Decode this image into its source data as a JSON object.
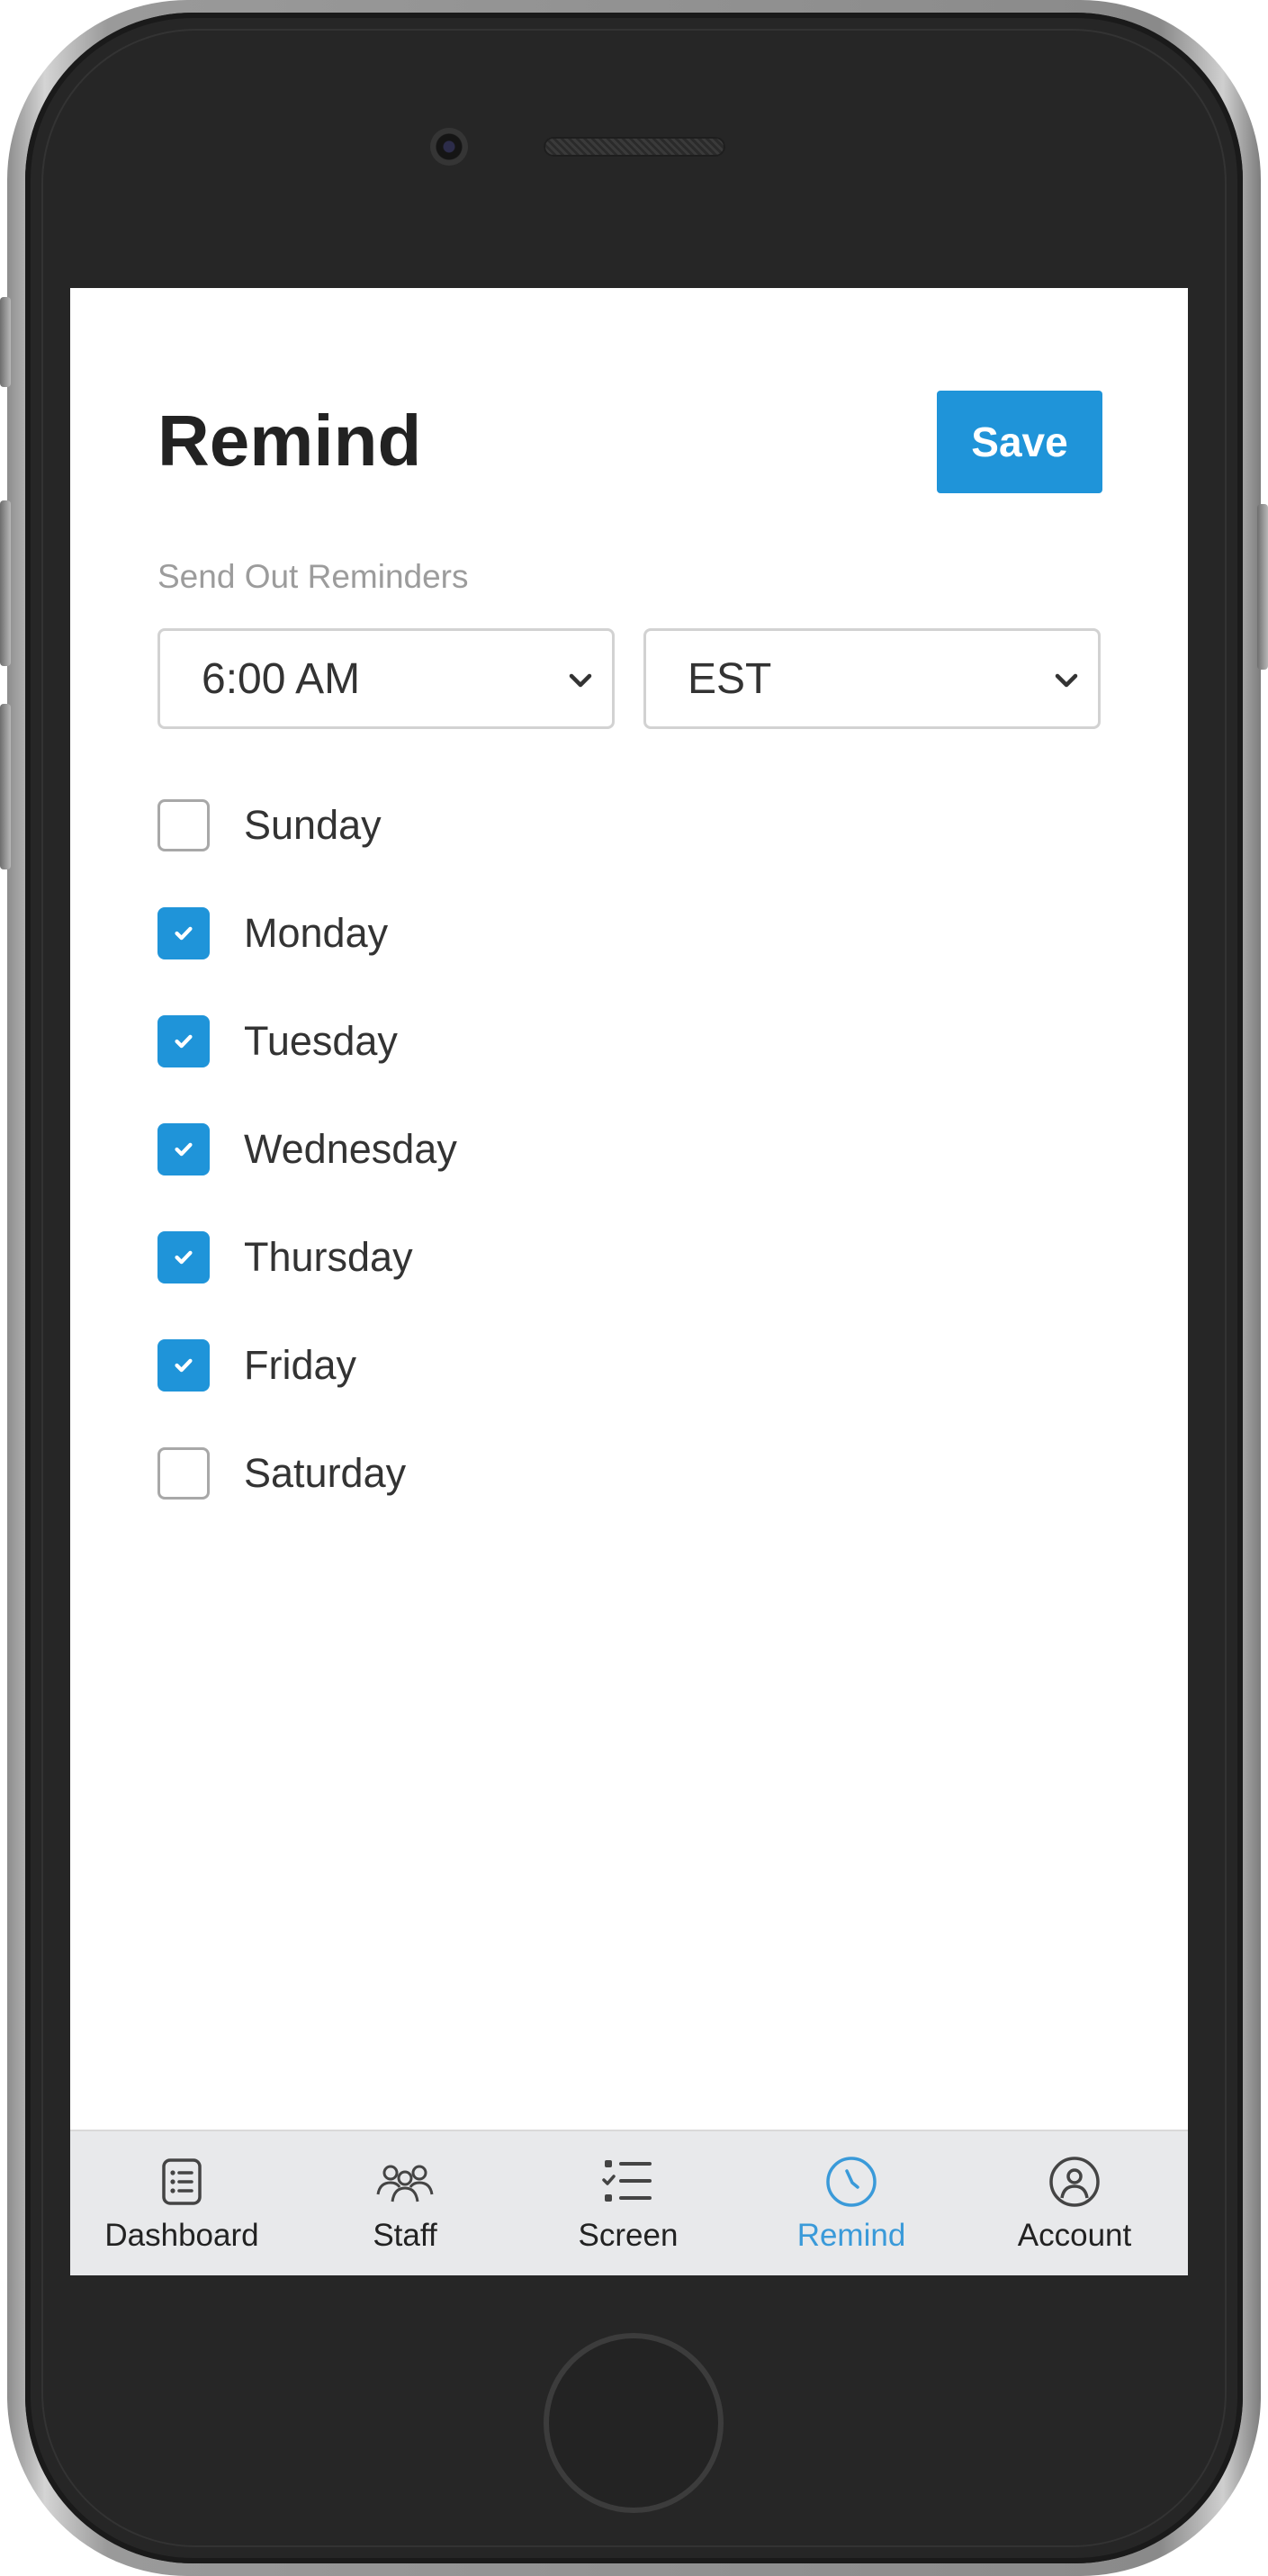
{
  "header": {
    "title": "Remind",
    "save_label": "Save"
  },
  "reminders": {
    "label": "Send Out Reminders",
    "time_value": "6:00 AM",
    "timezone_value": "EST"
  },
  "days": [
    {
      "label": "Sunday",
      "checked": false
    },
    {
      "label": "Monday",
      "checked": true
    },
    {
      "label": "Tuesday",
      "checked": true
    },
    {
      "label": "Wednesday",
      "checked": true
    },
    {
      "label": "Thursday",
      "checked": true
    },
    {
      "label": "Friday",
      "checked": true
    },
    {
      "label": "Saturday",
      "checked": false
    }
  ],
  "tabs": [
    {
      "label": "Dashboard",
      "icon": "dashboard-icon",
      "active": false
    },
    {
      "label": "Staff",
      "icon": "staff-icon",
      "active": false
    },
    {
      "label": "Screen",
      "icon": "checklist-icon",
      "active": false
    },
    {
      "label": "Remind",
      "icon": "clock-icon",
      "active": true
    },
    {
      "label": "Account",
      "icon": "account-icon",
      "active": false
    }
  ],
  "colors": {
    "accent": "#1f94d9",
    "active_tab": "#3a9ad9",
    "tab_bar_bg": "#e8e9eb"
  }
}
